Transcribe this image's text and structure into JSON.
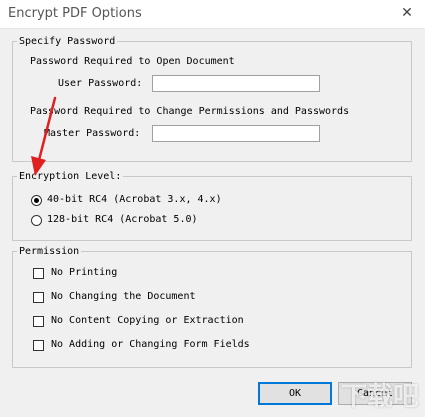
{
  "window": {
    "title": "Encrypt PDF Options",
    "close_glyph": "✕"
  },
  "password": {
    "legend": "Specify Password",
    "open_heading": "Password Required to Open Document",
    "user_label": "User Password:",
    "user_value": "",
    "perm_heading": "Password Required to Change Permissions and Passwords",
    "master_label": "Master Password:",
    "master_value": ""
  },
  "encryption": {
    "legend": "Encryption Level:",
    "options": [
      {
        "label": "40-bit RC4 (Acrobat 3.x, 4.x)",
        "selected": true
      },
      {
        "label": "128-bit RC4 (Acrobat 5.0)",
        "selected": false
      }
    ]
  },
  "permission": {
    "legend": "Permission",
    "options": [
      {
        "label": "No Printing",
        "checked": false
      },
      {
        "label": "No Changing the Document",
        "checked": false
      },
      {
        "label": "No Content Copying or Extraction",
        "checked": false
      },
      {
        "label": "No Adding or Changing Form Fields",
        "checked": false
      }
    ]
  },
  "buttons": {
    "ok": "OK",
    "cancel": "Cancel"
  },
  "annotation": {
    "arrow_color": "#e02020"
  }
}
